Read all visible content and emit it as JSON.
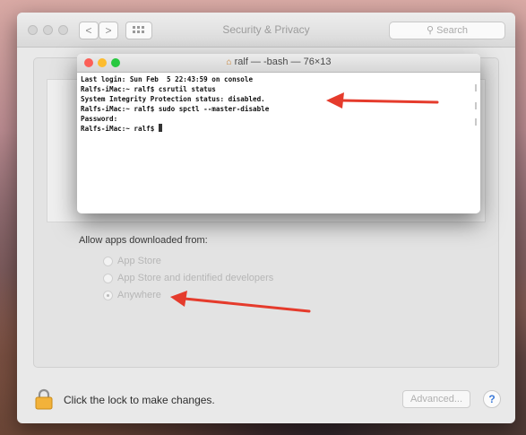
{
  "prefs_window": {
    "title": "Security & Privacy",
    "search_placeholder": "Search",
    "nav_back": "<",
    "nav_forward": ">",
    "grid_icon": "show-all-icon",
    "gatekeeper": {
      "label": "Allow apps downloaded from:",
      "options": [
        {
          "label": "App Store",
          "selected": false
        },
        {
          "label": "App Store and identified developers",
          "selected": false
        },
        {
          "label": "Anywhere",
          "selected": true
        }
      ]
    },
    "lock_text": "Click the lock to make changes.",
    "advanced_label": "Advanced...",
    "help_label": "?"
  },
  "terminal": {
    "title": "ralf — -bash — 76×13",
    "home_icon": "house-icon",
    "lines": [
      "Last login: Sun Feb  5 22:43:59 on console",
      "Ralfs-iMac:~ ralf$ csrutil status",
      "System Integrity Protection status: disabled.",
      "Ralfs-iMac:~ ralf$ sudo spctl --master-disable",
      "Password:",
      "Ralfs-iMac:~ ralf$ "
    ]
  },
  "colors": {
    "annotation_arrow": "#e53b2c",
    "traffic_close": "#fc5f57",
    "traffic_minimize": "#fdbc2e",
    "traffic_zoom": "#28c840"
  }
}
